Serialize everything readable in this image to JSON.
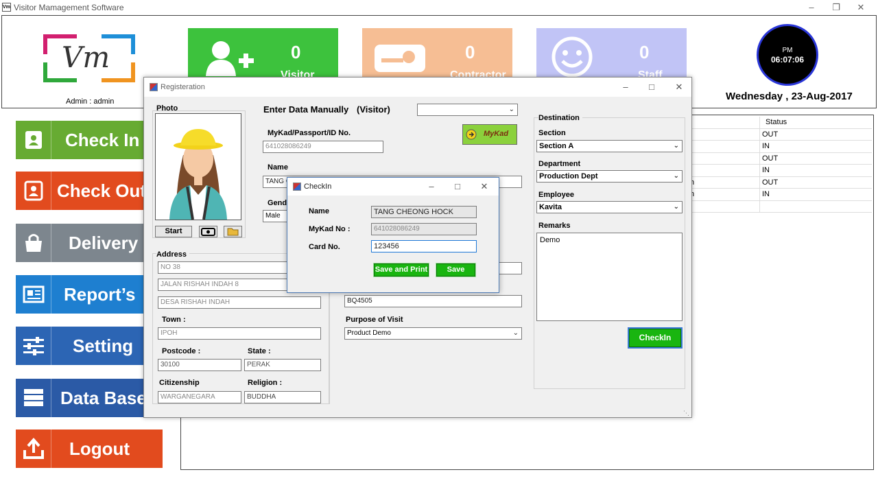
{
  "window": {
    "title": "Visitor Mamagement Software"
  },
  "header": {
    "logo_text": "Vm",
    "admin_label": "Admin : admin",
    "tiles": [
      {
        "count": "0",
        "label": "Visitor",
        "color": "#3dc23d",
        "icon": "add-user-icon"
      },
      {
        "count": "0",
        "label": "Contractor",
        "color": "#f6be94",
        "icon": "ticket-icon"
      },
      {
        "count": "0",
        "label": "Staff",
        "color": "#c1c4f6",
        "icon": "smiley-icon"
      }
    ],
    "clock": {
      "ampm": "PM",
      "time": "06:07:06"
    },
    "date": "Wednesday , 23-Aug-2017"
  },
  "sidebar": {
    "items": [
      {
        "label": "Check In",
        "color": "#67ab32",
        "icon": "address-book-icon"
      },
      {
        "label": "Check Out",
        "color": "#e24b1e",
        "icon": "contact-card-icon"
      },
      {
        "label": "Delivery",
        "color": "#7d868e",
        "icon": "shopping-bag-icon"
      },
      {
        "label": "Report’s",
        "color": "#1e7fd0",
        "icon": "newspaper-icon"
      },
      {
        "label": "Setting",
        "color": "#2c65b4",
        "icon": "sliders-icon"
      },
      {
        "label": "Data Base",
        "color": "#2b5aa6",
        "icon": "server-icon"
      },
      {
        "label": "Logout",
        "color": "#e24b1e",
        "icon": "upload-icon"
      }
    ]
  },
  "table": {
    "header": [
      "",
      "Status"
    ],
    "rows": [
      [
        "",
        "OUT"
      ],
      [
        "",
        "IN"
      ],
      [
        "",
        "OUT"
      ],
      [
        "",
        "IN"
      ],
      [
        "h",
        "OUT"
      ],
      [
        "h",
        "IN"
      ],
      [
        "",
        ""
      ]
    ]
  },
  "registration": {
    "title": "Registeration",
    "photo_label": "Photo",
    "start_button": "Start",
    "enter_manually": "Enter Data Manually",
    "visitor_type": "(Visitor)",
    "mykad_label": "MyKad/Passport/ID No.",
    "mykad_value": "641028086249",
    "mykad_button": "MyKad",
    "name_label": "Name",
    "name_value": "TANG C",
    "gender_label": "Gend",
    "gender_value": "Male",
    "address_label": "Address",
    "address_lines": [
      "NO 38",
      "JALAN RISHAH INDAH 8",
      "DESA RISHAH INDAH"
    ],
    "town_label": "Town :",
    "town_value": "IPOH",
    "postcode_label": "Postcode :",
    "postcode_value": "30100",
    "state_label": "State :",
    "state_value": "PERAK",
    "citizenship_label": "Citizenship",
    "citizenship_value": "WARGANEGARA",
    "religion_label": "Religion :",
    "religion_value": "BUDDHA",
    "vehicle_value": "BQ4505",
    "purpose_label": "Purpose of Visit",
    "purpose_value": "Product Demo",
    "destination_label": "Destination",
    "section_label": "Section",
    "section_value": "Section A",
    "department_label": "Department",
    "department_value": "Production Dept",
    "employee_label": "Employee",
    "employee_value": "Kavita",
    "remarks_label": "Remarks",
    "remarks_value": "Demo",
    "checkin_button": "CheckIn"
  },
  "checkin_dialog": {
    "title": "CheckIn",
    "name_label": "Name",
    "name_value": "TANG CHEONG HOCK",
    "mykad_label": "MyKad No :",
    "mykad_value": "641028086249",
    "card_label": "Card No.",
    "card_value": "123456",
    "save_print_button": "Save and Print",
    "save_button": "Save"
  }
}
